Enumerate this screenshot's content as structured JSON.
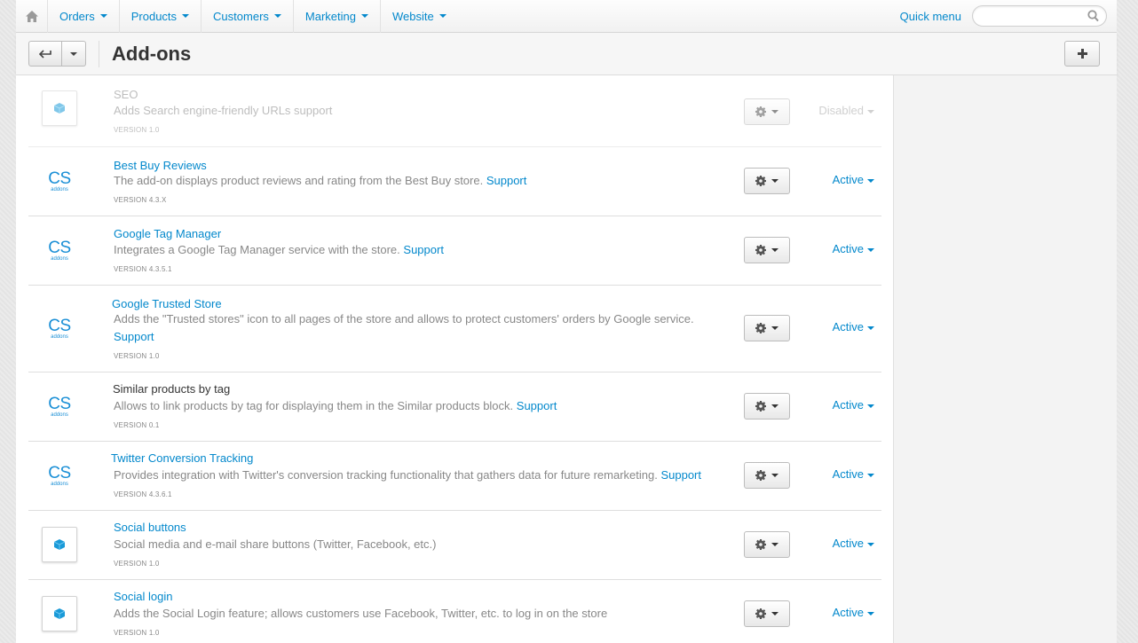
{
  "nav": {
    "items": [
      "Orders",
      "Products",
      "Customers",
      "Marketing",
      "Website"
    ],
    "quick_menu": "Quick menu",
    "search_value": ""
  },
  "header": {
    "title": "Add-ons"
  },
  "addons": [
    {
      "name": "SEO",
      "description": "Adds Search engine-friendly URLs support",
      "support": "",
      "version": "VERSION 1.0",
      "status": "Disabled",
      "icon": "box-icon"
    },
    {
      "name": "Best Buy Reviews",
      "description": "The add-on displays product reviews and rating from the Best Buy store.",
      "support": "Support",
      "version": "VERSION 4.3.X",
      "status": "Active",
      "icon": "cs-addons-logo"
    },
    {
      "name": "Google Tag Manager",
      "description": "Integrates a Google Tag Manager service with the store.",
      "support": "Support",
      "version": "VERSION 4.3.5.1",
      "status": "Active",
      "icon": "cs-addons-logo"
    },
    {
      "name": "Google Trusted Store",
      "description": "Adds the \"Trusted stores\" icon to all pages of the store and allows to protect customers' orders by Google service.",
      "support": "Support",
      "version": "VERSION 1.0",
      "status": "Active",
      "icon": "cs-addons-logo"
    },
    {
      "name": "Similar products by tag",
      "description": "Allows to link products by tag for displaying them in the Similar products block.",
      "support": "Support",
      "version": "VERSION 0.1",
      "status": "Active",
      "icon": "cs-addons-logo"
    },
    {
      "name": "Twitter Conversion Tracking",
      "description": "Provides integration with Twitter's conversion tracking functionality that gathers data for future remarketing.",
      "support": "Support",
      "version": "VERSION 4.3.6.1",
      "status": "Active",
      "icon": "cs-addons-logo"
    },
    {
      "name": "Social buttons",
      "description": "Social media and e-mail share buttons (Twitter, Facebook, etc.)",
      "support": "",
      "version": "VERSION 1.0",
      "status": "Active",
      "icon": "box-icon"
    },
    {
      "name": "Social login",
      "description": "Adds the Social Login feature; allows customers use Facebook, Twitter, etc. to log in on the store",
      "support": "",
      "version": "VERSION 1.0",
      "status": "Active",
      "icon": "box-icon"
    }
  ],
  "cs_logo": {
    "top": "CS",
    "bottom": "addons"
  },
  "colors": {
    "link": "#0388cc",
    "muted": "#888888",
    "disabled": "#aaaaaa"
  }
}
